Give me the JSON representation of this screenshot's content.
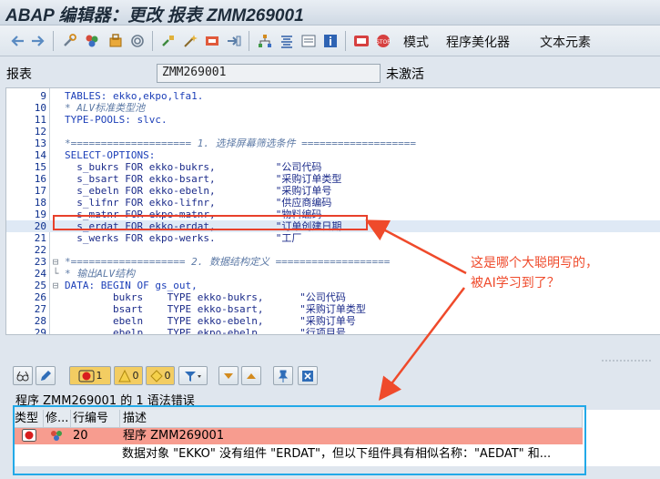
{
  "window": {
    "title": "ABAP 编辑器：更改 报表 ZMM269001"
  },
  "toolbar": {
    "text_buttons": [
      "模式",
      "程序美化器",
      "文本元素"
    ],
    "icons": [
      "back-arrow-icon",
      "forward-arrow-icon",
      "tools-icon",
      "object-icon",
      "toggle-display-icon",
      "where-used-icon",
      "check-icon",
      "activate-icon",
      "test-icon",
      "object-list-icon",
      "hierarchy-icon",
      "pretty-icon",
      "frame-icon",
      "info-icon",
      "breakpoint-icon",
      "session-breakpoint-icon"
    ]
  },
  "program": {
    "label": "报表",
    "name": "ZMM269001",
    "status": "未激活"
  },
  "editor": {
    "lines": [
      {
        "n": "9",
        "fold": "",
        "text": "TABLES: ekko,ekpo,lfa1.",
        "kind": "keyword"
      },
      {
        "n": "10",
        "fold": "",
        "text": "* ALV标准类型池",
        "kind": "comment"
      },
      {
        "n": "11",
        "fold": "",
        "text": "TYPE-POOLS: slvc.",
        "kind": "keyword"
      },
      {
        "n": "12",
        "fold": "",
        "text": "",
        "kind": "code"
      },
      {
        "n": "13",
        "fold": "",
        "text": "*==================== 1. 选择屏幕筛选条件 ===================",
        "kind": "comment"
      },
      {
        "n": "14",
        "fold": "",
        "text": "SELECT-OPTIONS:",
        "kind": "keyword"
      },
      {
        "n": "15",
        "fold": "",
        "text": "  s_bukrs FOR ekko-bukrs,          \"公司代码",
        "kind": "code"
      },
      {
        "n": "16",
        "fold": "",
        "text": "  s_bsart FOR ekko-bsart,          \"采购订单类型",
        "kind": "code"
      },
      {
        "n": "17",
        "fold": "",
        "text": "  s_ebeln FOR ekko-ebeln,          \"采购订单号",
        "kind": "code"
      },
      {
        "n": "18",
        "fold": "",
        "text": "  s_lifnr FOR ekko-lifnr,          \"供应商编码",
        "kind": "code"
      },
      {
        "n": "19",
        "fold": "",
        "text": "  s_matnr FOR ekpo-matnr,          \"物料编码",
        "kind": "code"
      },
      {
        "n": "20",
        "fold": "",
        "text": "  s_erdat FOR ekko-erdat,          \"订单创建日期",
        "kind": "code"
      },
      {
        "n": "21",
        "fold": "",
        "text": "  s_werks FOR ekpo-werks.          \"工厂",
        "kind": "code"
      },
      {
        "n": "22",
        "fold": "",
        "text": "",
        "kind": "code"
      },
      {
        "n": "23",
        "fold": "⊟",
        "text": "*=================== 2. 数据结构定义 ===================",
        "kind": "comment"
      },
      {
        "n": "24",
        "fold": "└",
        "text": "* 输出ALV结构",
        "kind": "comment"
      },
      {
        "n": "25",
        "fold": "⊟",
        "text": "DATA: BEGIN OF gs_out,",
        "kind": "keyword"
      },
      {
        "n": "26",
        "fold": "",
        "text": "        bukrs    TYPE ekko-bukrs,      \"公司代码",
        "kind": "code"
      },
      {
        "n": "27",
        "fold": "",
        "text": "        bsart    TYPE ekko-bsart,      \"采购订单类型",
        "kind": "code"
      },
      {
        "n": "28",
        "fold": "",
        "text": "        ebeln    TYPE ekko-ebeln,      \"采购订单号",
        "kind": "code"
      },
      {
        "n": "29",
        "fold": "",
        "text": "        ebelp    TYPE ekpo-ebelp,      \"行项目号",
        "kind": "code"
      }
    ]
  },
  "annotation": {
    "line1": "这是哪个大聪明写的，",
    "line2": "被AI学习到了？"
  },
  "error_toolbar": {
    "error_count": "1",
    "warning_count": "0",
    "info_count": "0"
  },
  "error_panel": {
    "summary": "程序 ZMM269001 的 1 语法错误",
    "columns": [
      "类型",
      "修...",
      "行编号",
      "描述"
    ],
    "row": {
      "line": "20",
      "program": "程序 ZMM269001",
      "message": "数据对象 \"EKKO\" 没有组件 \"ERDAT\"，但以下组件具有相似名称：\"AEDAT\" 和..."
    }
  },
  "colors": {
    "highlight_red": "#e8402a",
    "annotation_red": "#ef4a2b",
    "focus_blue": "#22a9e8",
    "error_row": "#f79c8f"
  }
}
